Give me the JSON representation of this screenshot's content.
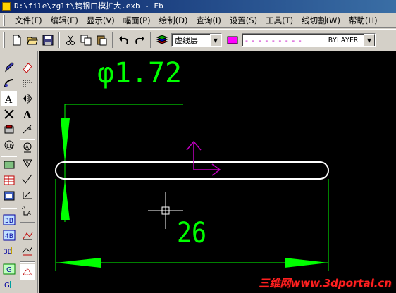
{
  "window": {
    "title": "D:\\file\\zglt\\钨钢口模扩大.exb - Eb"
  },
  "menubar": {
    "items": [
      {
        "label": "文件(F)"
      },
      {
        "label": "编辑(E)"
      },
      {
        "label": "显示(V)"
      },
      {
        "label": "幅面(P)"
      },
      {
        "label": "绘制(D)"
      },
      {
        "label": "查询(I)"
      },
      {
        "label": "设置(S)"
      },
      {
        "label": "工具(T)"
      },
      {
        "label": "线切割(W)"
      },
      {
        "label": "帮助(H)"
      }
    ]
  },
  "toolbar": {
    "layer_combo_value": "虚线层",
    "linetype_combo_value": "- - - - - - - - -",
    "linetype_name": "BYLAYER"
  },
  "drawing": {
    "diameter_dimension": "φ1.72",
    "length_dimension": "26"
  },
  "colors": {
    "canvas_bg": "#000000",
    "dimension": "#00ff00",
    "outline": "#ffffff",
    "axis_marker": "#c000c0"
  },
  "watermark": "三维网www.3dportal.cn"
}
